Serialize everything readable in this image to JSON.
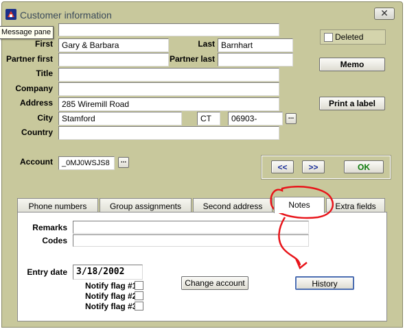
{
  "window": {
    "title": "Customer information",
    "close_label": "✕",
    "tooltip": "Message pane"
  },
  "form": {
    "labels": {
      "first": "First",
      "last": "Last",
      "partner_first": "Partner first",
      "partner_last": "Partner last",
      "title": "Title",
      "company": "Company",
      "address": "Address",
      "city": "City",
      "country": "Country",
      "account": "Account"
    },
    "values": {
      "first": "Gary & Barbara",
      "last": "Barnhart",
      "partner_first": "",
      "partner_last": "",
      "title": "",
      "company": "",
      "address": "285 Wiremill Road",
      "city": "Stamford",
      "state": "CT",
      "zip": "06903-",
      "country": "",
      "account": "_0MJ0WSJS8"
    },
    "ellipsis": "..."
  },
  "side": {
    "deleted_label": "Deleted",
    "memo_label": "Memo",
    "print_label": "Print a label"
  },
  "nav": {
    "prev_label": "<<",
    "next_label": ">>",
    "ok_label": "OK"
  },
  "tabs": [
    {
      "label": "Phone numbers"
    },
    {
      "label": "Group assignments"
    },
    {
      "label": "Second address"
    },
    {
      "label": "Notes"
    },
    {
      "label": "Extra fields"
    }
  ],
  "notes": {
    "remarks_label": "Remarks",
    "codes_label": "Codes",
    "remarks_value": "",
    "codes_value": "",
    "entry_date_label": "Entry date",
    "entry_date_value": "3/18/2002",
    "flag1_label": "Notify flag #1",
    "flag2_label": "Notify flag #2",
    "flag3_label": "Notify flag #3",
    "change_account_label": "Change account",
    "history_label": "History"
  },
  "colors": {
    "window_bg": "#c8c89c",
    "annotation": "#e8141a"
  }
}
